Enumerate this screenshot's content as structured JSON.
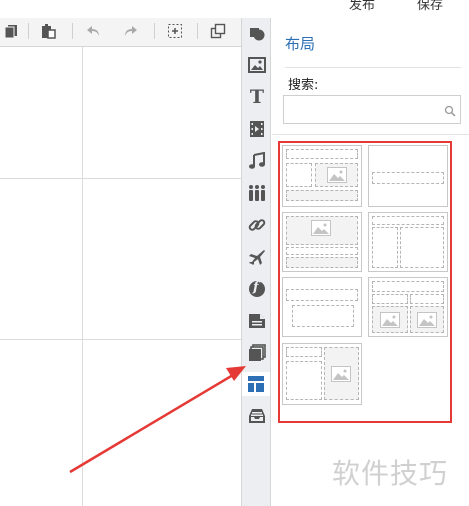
{
  "header": {
    "publish_label": "发布",
    "save_label": "保存"
  },
  "toolbar": {
    "icons": [
      "copy-icon",
      "paste-icon",
      "undo-icon",
      "redo-icon",
      "select-frame-icon",
      "layer-arrange-icon"
    ]
  },
  "rail": {
    "icons": [
      "shape-icon",
      "image-icon",
      "text-icon",
      "video-icon",
      "music-icon",
      "people-icon",
      "link-icon",
      "plane-icon",
      "flash-icon",
      "slides-icon",
      "stack-icon",
      "layout-icon",
      "inbox-icon"
    ],
    "text_glyph": "T",
    "flash_glyph": "f",
    "active": "layout-icon"
  },
  "panel": {
    "title": "布局",
    "search_label": "搜索:",
    "search_value": "",
    "search_placeholder": ""
  },
  "layouts": [
    "layout-1",
    "layout-2",
    "layout-3",
    "layout-4",
    "layout-5",
    "layout-6",
    "layout-7"
  ],
  "watermark": "软件技巧",
  "colors": {
    "accent": "#2c6fb5",
    "highlight": "#e53935",
    "arrow": "#e53935"
  }
}
